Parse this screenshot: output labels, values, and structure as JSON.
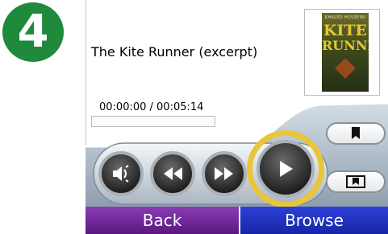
{
  "step_badge": {
    "number": "4",
    "color": "#1f8a3c"
  },
  "track": {
    "title": "The Kite Runner (excerpt)",
    "time": "00:00:00 / 00:05:14",
    "progress": 0
  },
  "cover": {
    "author": "KHALED HOSSEINI",
    "title_line1": "KITE",
    "title_line2": "RUNNER"
  },
  "controls": {
    "volume": "speaker-icon",
    "rewind": "rewind-icon",
    "fast_forward": "fast-forward-icon",
    "play": "play-icon",
    "bookmark": "bookmark-icon",
    "bookmarks_list": "bookmarks-list-icon",
    "highlight_color": "#e9c53a"
  },
  "nav": {
    "back_label": "Back",
    "browse_label": "Browse"
  }
}
